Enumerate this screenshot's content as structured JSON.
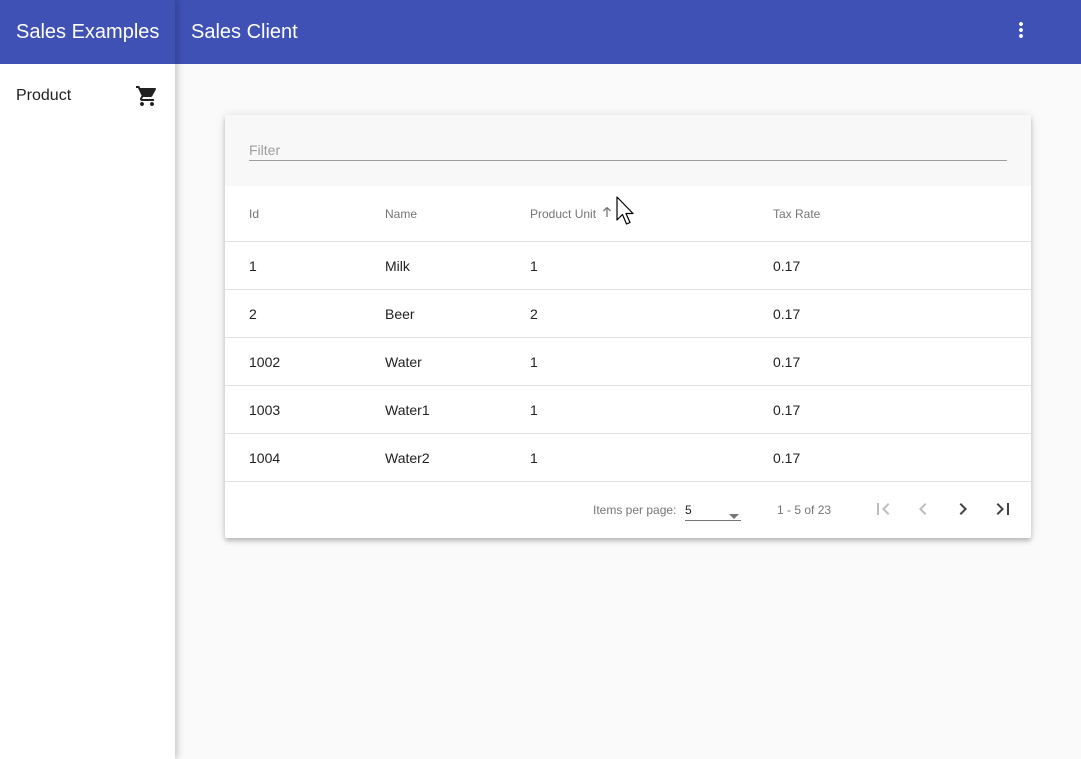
{
  "sidebar": {
    "title": "Sales Examples",
    "items": [
      {
        "label": "Product",
        "icon": "shopping-cart-icon"
      }
    ]
  },
  "toolbar": {
    "title": "Sales Client",
    "menu_icon": "more-vert-icon"
  },
  "filter": {
    "placeholder": "Filter",
    "value": ""
  },
  "table": {
    "columns": [
      "Id",
      "Name",
      "Product Unit",
      "Tax Rate"
    ],
    "sort": {
      "column": "Product Unit",
      "direction": "asc"
    },
    "rows": [
      [
        "1",
        "Milk",
        "1",
        "0.17"
      ],
      [
        "2",
        "Beer",
        "2",
        "0.17"
      ],
      [
        "1002",
        "Water",
        "1",
        "0.17"
      ],
      [
        "1003",
        "Water1",
        "1",
        "0.17"
      ],
      [
        "1004",
        "Water2",
        "1",
        "0.17"
      ]
    ]
  },
  "paginator": {
    "items_per_page_label": "Items per page:",
    "page_size": "5",
    "range_label": "1 - 5 of 23"
  },
  "colors": {
    "primary": "#3f51b5",
    "background": "#fafafa"
  }
}
